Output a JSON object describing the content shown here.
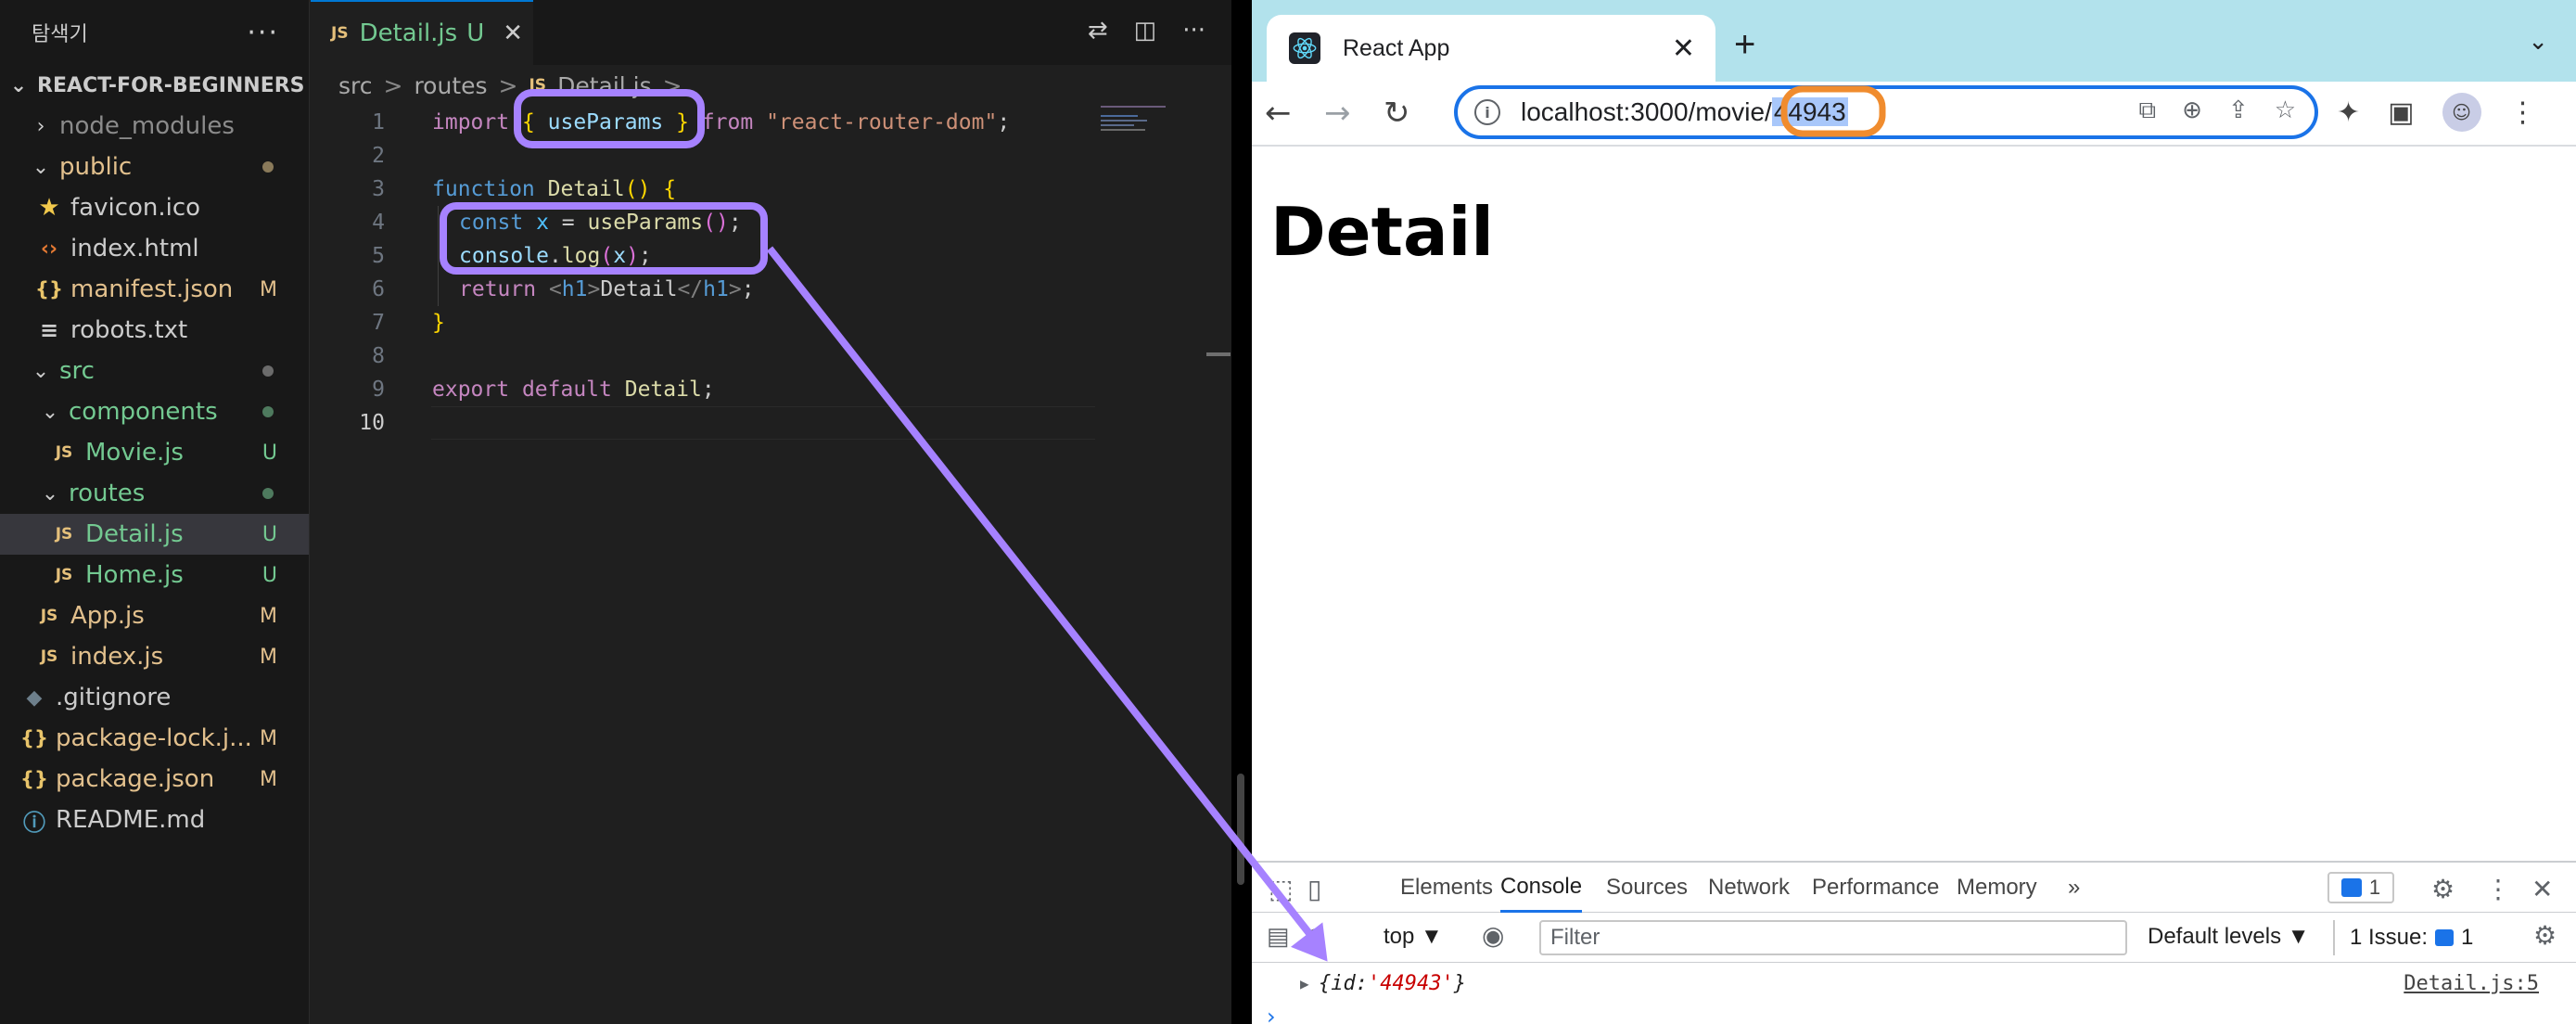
{
  "explorer": {
    "title": "탐색기",
    "more": "···",
    "root": "REACT-FOR-BEGINNERS",
    "items": [
      {
        "label": "node_modules",
        "status": ""
      },
      {
        "label": "public",
        "status": ""
      },
      {
        "label": "favicon.ico",
        "status": ""
      },
      {
        "label": "index.html",
        "status": ""
      },
      {
        "label": "manifest.json",
        "status": "M"
      },
      {
        "label": "robots.txt",
        "status": ""
      },
      {
        "label": "src",
        "status": ""
      },
      {
        "label": "components",
        "status": ""
      },
      {
        "label": "Movie.js",
        "status": "U"
      },
      {
        "label": "routes",
        "status": ""
      },
      {
        "label": "Detail.js",
        "status": "U"
      },
      {
        "label": "Home.js",
        "status": "U"
      },
      {
        "label": "App.js",
        "status": "M"
      },
      {
        "label": "index.js",
        "status": "M"
      },
      {
        "label": ".gitignore",
        "status": ""
      },
      {
        "label": "package-lock.j...",
        "status": "M"
      },
      {
        "label": "package.json",
        "status": "M"
      },
      {
        "label": "README.md",
        "status": ""
      }
    ]
  },
  "editor": {
    "tab": {
      "icon": "JS",
      "name": "Detail.js",
      "status": "U",
      "close": "✕"
    },
    "breadcrumb": {
      "part1": "src",
      "part2": "routes",
      "icon": "JS",
      "part3": "Detail.js",
      "sep": ">"
    },
    "line_numbers": [
      "1",
      "2",
      "3",
      "4",
      "5",
      "6",
      "7",
      "8",
      "9",
      "10"
    ],
    "code": {
      "l1": {
        "a": "import ",
        "b": "{ ",
        "c": "useParams",
        "d": " } ",
        "e": "from ",
        "f": "\"react-router-dom\"",
        "g": ";"
      },
      "l3": {
        "a": "function ",
        "b": "Detail",
        "c": "() ",
        "d": "{"
      },
      "l4": {
        "a": "const ",
        "b": "x",
        "c": " = ",
        "d": "useParams",
        "e": "()",
        "f": ";"
      },
      "l5": {
        "a": "console",
        "b": ".",
        "c": "log",
        "d": "(",
        "e": "x",
        "f": ")",
        "g": ";"
      },
      "l6": {
        "a": "return ",
        "b": "<",
        "c": "h1",
        "d": ">",
        "e": "Detail",
        "f": "</",
        "g": "h1",
        "h": ">",
        "i": ";"
      },
      "l7": {
        "a": "}"
      },
      "l9": {
        "a": "export ",
        "b": "default ",
        "c": "Detail",
        "d": ";"
      }
    }
  },
  "browser": {
    "tab_title": "React App",
    "tab_close": "✕",
    "new_tab": "+",
    "url_prefix": "localhost:3000/movie/",
    "url_param": "44943",
    "page_heading": "Detail"
  },
  "devtools": {
    "tabs": [
      "Elements",
      "Console",
      "Sources",
      "Network",
      "Performance",
      "Memory"
    ],
    "overflow": "»",
    "messages_badge": "1",
    "context": "top ▼",
    "filter_placeholder": "Filter",
    "levels": "Default levels ▼",
    "issues": "1 Issue:",
    "issues_count": "1",
    "log_open": "{id: ",
    "log_value": "'44943'",
    "log_close": "}",
    "log_source": "Detail.js:5",
    "prompt": "›"
  },
  "colors": {
    "annotation_purple": "#a682ff",
    "annotation_orange": "#f08c2e",
    "accent_blue": "#1a73e8"
  }
}
